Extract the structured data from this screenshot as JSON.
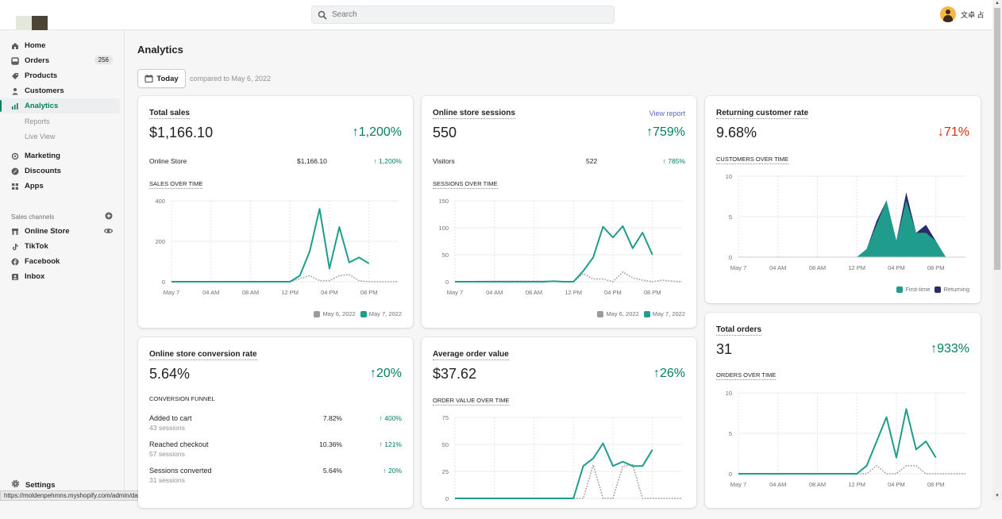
{
  "header": {
    "search_placeholder": "Search",
    "user_name": "文卓 占"
  },
  "sidebar": {
    "items": [
      {
        "label": "Home",
        "icon": "home-icon"
      },
      {
        "label": "Orders",
        "icon": "orders-icon",
        "badge": "256"
      },
      {
        "label": "Products",
        "icon": "tag-icon"
      },
      {
        "label": "Customers",
        "icon": "person-icon"
      },
      {
        "label": "Analytics",
        "icon": "bar-chart-icon",
        "active": true
      }
    ],
    "analytics_sub": [
      "Reports",
      "Live View"
    ],
    "items2": [
      {
        "label": "Marketing",
        "icon": "marketing-icon"
      },
      {
        "label": "Discounts",
        "icon": "discount-icon"
      },
      {
        "label": "Apps",
        "icon": "apps-icon"
      }
    ],
    "sales_channels_label": "Sales channels",
    "channels": [
      {
        "label": "Online Store",
        "icon": "store-icon"
      },
      {
        "label": "TikTok",
        "icon": "tiktok-icon"
      },
      {
        "label": "Facebook",
        "icon": "facebook-icon"
      },
      {
        "label": "Inbox",
        "icon": "inbox-icon"
      }
    ],
    "settings_label": "Settings"
  },
  "status_url": "https://moldenpehmns.myshopify.com/admin/dashboards",
  "page": {
    "title": "Analytics",
    "date_button": "Today",
    "compared_to": "compared to May 6, 2022"
  },
  "colors": {
    "current": "#1f9c8c",
    "previous": "#9a9ca0",
    "returning": "#2b2a6b",
    "positive": "#007f5f",
    "negative": "#d72c0d"
  },
  "cards": {
    "total_sales": {
      "title": "Total sales",
      "value": "$1,166.10",
      "delta": "↑1,200%",
      "sub_label": "Online Store",
      "sub_value": "$1,166.10",
      "sub_delta": "↑ 1,200%",
      "section": "SALES OVER TIME",
      "legend": [
        "May 6, 2022",
        "May 7, 2022"
      ]
    },
    "sessions": {
      "title": "Online store sessions",
      "link": "View report",
      "value": "550",
      "delta": "↑759%",
      "sub_label": "Visitors",
      "sub_value": "522",
      "sub_delta": "↑ 785%",
      "section": "SESSIONS OVER TIME",
      "legend": [
        "May 6, 2022",
        "May 7, 2022"
      ]
    },
    "returning": {
      "title": "Returning customer rate",
      "value": "9.68%",
      "delta": "↓71%",
      "section": "CUSTOMERS OVER TIME",
      "legend": [
        "First-time",
        "Returning"
      ]
    },
    "conversion": {
      "title": "Online store conversion rate",
      "value": "5.64%",
      "delta": "↑20%",
      "section": "CONVERSION FUNNEL",
      "funnel": [
        {
          "label": "Added to cart",
          "sessions": "43 sessions",
          "pct": "7.82%",
          "delta": "↑ 400%"
        },
        {
          "label": "Reached checkout",
          "sessions": "57 sessions",
          "pct": "10.36%",
          "delta": "↑ 121%"
        },
        {
          "label": "Sessions converted",
          "sessions": "31 sessions",
          "pct": "5.64%",
          "delta": "↑ 20%"
        }
      ]
    },
    "aov": {
      "title": "Average order value",
      "value": "$37.62",
      "delta": "↑26%",
      "section": "ORDER VALUE OVER TIME"
    },
    "orders": {
      "title": "Total orders",
      "value": "31",
      "delta": "↑933%",
      "section": "ORDERS OVER TIME"
    }
  },
  "chart_data": [
    {
      "id": "sales",
      "type": "line",
      "title": "SALES OVER TIME",
      "x_ticks": [
        "May 7",
        "04 AM",
        "08 AM",
        "12 PM",
        "04 PM",
        "08 PM"
      ],
      "x_range_hours": [
        0,
        23
      ],
      "ylim": [
        0,
        400
      ],
      "y_ticks": [
        0,
        200,
        400
      ],
      "series": [
        {
          "name": "May 7, 2022",
          "style": "solid",
          "x": [
            0,
            1,
            2,
            3,
            4,
            5,
            6,
            7,
            8,
            9,
            10,
            11,
            12,
            13,
            14,
            15,
            16,
            17,
            18,
            19,
            20
          ],
          "values": [
            0,
            0,
            0,
            0,
            0,
            0,
            0,
            0,
            0,
            0,
            0,
            0,
            0,
            30,
            150,
            360,
            65,
            270,
            95,
            120,
            90
          ]
        },
        {
          "name": "May 6, 2022",
          "style": "dotted",
          "x": [
            0,
            12,
            13,
            14,
            15,
            16,
            17,
            18,
            19,
            20,
            21,
            22,
            23
          ],
          "values": [
            0,
            0,
            15,
            30,
            5,
            5,
            30,
            35,
            5,
            0,
            0,
            0,
            0
          ]
        }
      ],
      "legend": "bottom-right"
    },
    {
      "id": "sessions",
      "type": "line",
      "title": "SESSIONS OVER TIME",
      "x_ticks": [
        "May 7",
        "04 AM",
        "08 AM",
        "12 PM",
        "04 PM",
        "08 PM"
      ],
      "x_range_hours": [
        0,
        23
      ],
      "ylim": [
        0,
        150
      ],
      "y_ticks": [
        0,
        50,
        100,
        150
      ],
      "series": [
        {
          "name": "May 7, 2022",
          "style": "solid",
          "x": [
            0,
            1,
            2,
            3,
            4,
            5,
            6,
            7,
            8,
            9,
            10,
            11,
            12,
            13,
            14,
            15,
            16,
            17,
            18,
            19,
            20
          ],
          "values": [
            0,
            0,
            0,
            0,
            0,
            0,
            0,
            0,
            0,
            0,
            1,
            0,
            0,
            20,
            45,
            102,
            82,
            103,
            62,
            91,
            50
          ]
        },
        {
          "name": "May 6, 2022",
          "style": "dotted",
          "x": [
            0,
            4,
            9,
            12,
            13,
            14,
            15,
            16,
            17,
            18,
            19,
            20,
            21,
            22,
            23
          ],
          "values": [
            0,
            1,
            1,
            0,
            15,
            5,
            5,
            0,
            18,
            7,
            3,
            0,
            3,
            1,
            0
          ]
        }
      ],
      "legend": "bottom-right"
    },
    {
      "id": "customers",
      "type": "area",
      "stacked": true,
      "title": "CUSTOMERS OVER TIME",
      "x_ticks": [
        "May 7",
        "04 AM",
        "08 AM",
        "12 PM",
        "04 PM",
        "08 PM"
      ],
      "x_range_hours": [
        0,
        23
      ],
      "ylim": [
        0,
        10
      ],
      "y_ticks": [
        0,
        5,
        10
      ],
      "series": [
        {
          "name": "First-time",
          "x": [
            12,
            13,
            14,
            15,
            16,
            17,
            18,
            19,
            20,
            21
          ],
          "values": [
            0,
            1,
            4,
            7,
            2,
            7,
            3,
            3,
            2,
            0
          ]
        },
        {
          "name": "Returning",
          "x": [
            12,
            13,
            14,
            15,
            16,
            17,
            18,
            19,
            20,
            21
          ],
          "values": [
            0,
            0,
            0.5,
            0,
            0,
            1,
            0,
            1,
            0,
            0
          ]
        }
      ],
      "legend": "bottom-right"
    },
    {
      "id": "aov",
      "type": "line",
      "title": "ORDER VALUE OVER TIME",
      "x_range_hours": [
        0,
        23
      ],
      "ylim": [
        0,
        75
      ],
      "y_ticks": [
        0,
        25,
        50,
        75
      ],
      "series": [
        {
          "name": "May 7, 2022",
          "style": "solid",
          "x": [
            0,
            12,
            13,
            14,
            15,
            16,
            17,
            18,
            19,
            20
          ],
          "values": [
            0,
            0,
            30,
            37,
            51,
            30,
            34,
            30,
            30,
            45
          ]
        },
        {
          "name": "May 6, 2022",
          "style": "dotted",
          "x": [
            0,
            13,
            14,
            15,
            16,
            17,
            18,
            19,
            20,
            21,
            22,
            23
          ],
          "values": [
            0,
            0,
            31,
            0,
            0,
            30,
            31,
            0,
            0,
            0,
            0,
            0
          ]
        }
      ]
    },
    {
      "id": "orders",
      "type": "line",
      "title": "ORDERS OVER TIME",
      "x_ticks": [
        "May 7",
        "04 AM",
        "08 AM",
        "12 PM",
        "04 PM",
        "08 PM"
      ],
      "x_range_hours": [
        0,
        23
      ],
      "ylim": [
        0,
        10
      ],
      "y_ticks": [
        0,
        5,
        10
      ],
      "series": [
        {
          "name": "May 7, 2022",
          "style": "solid",
          "x": [
            0,
            12,
            13,
            14,
            15,
            16,
            17,
            18,
            19,
            20
          ],
          "values": [
            0,
            0,
            1,
            4,
            7,
            2,
            8,
            3,
            4,
            2
          ]
        },
        {
          "name": "May 6, 2022",
          "style": "dotted",
          "x": [
            0,
            13,
            14,
            15,
            16,
            17,
            18,
            19,
            20,
            21,
            22,
            23
          ],
          "values": [
            0,
            0,
            1,
            0,
            0,
            1,
            1,
            0,
            0,
            0,
            0,
            0
          ]
        }
      ]
    }
  ]
}
